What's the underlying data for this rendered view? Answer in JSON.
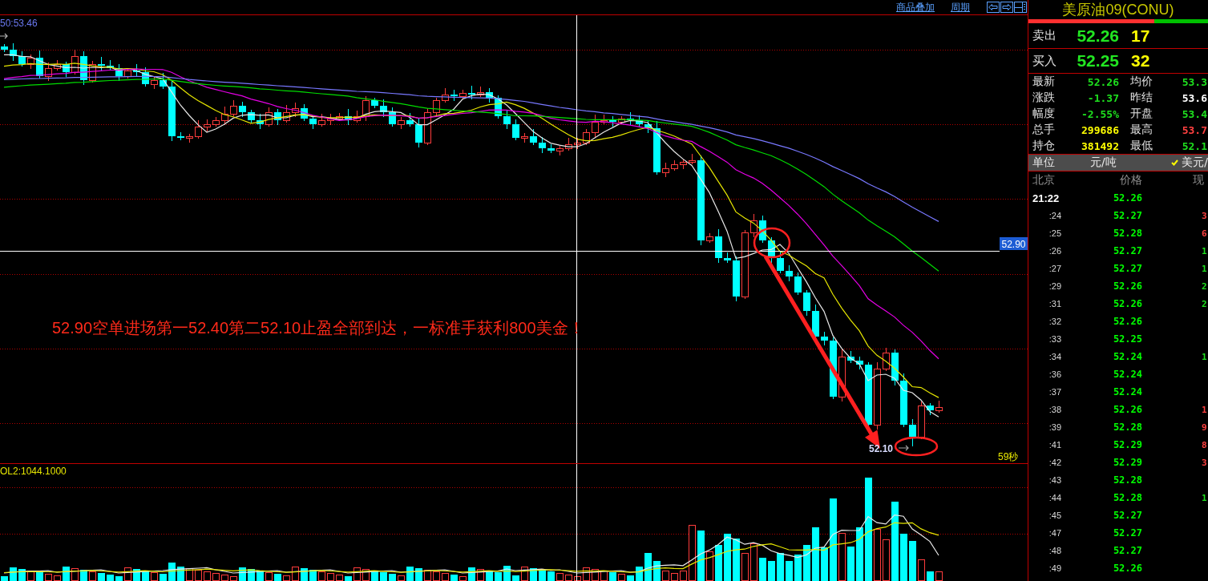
{
  "toolbar": {
    "links": [
      "商品叠加",
      "周期"
    ]
  },
  "price_chart": {
    "time_label": "50:53.46",
    "crosshair_label": "52.90",
    "annotation": "52.90空单进场第一52.40第二52.10止盈全部到达，一标准手获利800美金！",
    "low_label": "52.10",
    "countdown": "59秒"
  },
  "volume_chart": {
    "indicator_label": "OL2:1044.1000"
  },
  "quote_panel": {
    "title": "美原油09(CONU)",
    "ratio_bar": {
      "level": 0.7
    },
    "book": [
      {
        "label": "卖出",
        "price": "52.26",
        "volume": "17"
      },
      {
        "label": "买入",
        "price": "52.25",
        "volume": "32"
      }
    ],
    "stats": [
      {
        "label": "最新",
        "value": "52.26",
        "color": "#1ee01e"
      },
      {
        "label": "均价",
        "value": "53.3",
        "color": "#1ee01e"
      },
      {
        "label": "涨跌",
        "value": "-1.37",
        "color": "#1ee01e"
      },
      {
        "label": "昨结",
        "value": "53.6",
        "color": "#ffffff"
      },
      {
        "label": "幅度",
        "value": "-2.55%",
        "color": "#1ee01e"
      },
      {
        "label": "开盘",
        "value": "53.4",
        "color": "#1ee01e"
      },
      {
        "label": "总手",
        "value": "299686",
        "color": "#ffff00"
      },
      {
        "label": "最高",
        "value": "53.7",
        "color": "#ff4040"
      },
      {
        "label": "持仓",
        "value": "381492",
        "color": "#ffff00"
      },
      {
        "label": "最低",
        "value": "52.1",
        "color": "#1ee01e"
      }
    ],
    "units": {
      "label": "单位",
      "options": [
        {
          "label": "元/吨",
          "selected": false
        },
        {
          "label": "美元/",
          "selected": true
        }
      ]
    },
    "ticks": {
      "columns": [
        "北京",
        "价格",
        "现"
      ],
      "rows": [
        {
          "time": "21:22",
          "price": "52.26"
        },
        {
          "time": ":24",
          "price": "52.27",
          "volume": "3",
          "color": "#ff4040"
        },
        {
          "time": ":25",
          "price": "52.28",
          "volume": "6",
          "color": "#ff4040"
        },
        {
          "time": ":26",
          "price": "52.27",
          "volume": "1",
          "color": "#1ee01e"
        },
        {
          "time": ":27",
          "price": "52.27",
          "volume": "1",
          "color": "#1ee01e"
        },
        {
          "time": ":29",
          "price": "52.26",
          "volume": "2",
          "color": "#1ee01e"
        },
        {
          "time": ":31",
          "price": "52.26",
          "volume": "2",
          "color": "#1ee01e"
        },
        {
          "time": ":32",
          "price": "52.26"
        },
        {
          "time": ":33",
          "price": "52.25"
        },
        {
          "time": ":34",
          "price": "52.24",
          "volume": "1",
          "color": "#1ee01e"
        },
        {
          "time": ":36",
          "price": "52.24"
        },
        {
          "time": ":37",
          "price": "52.24"
        },
        {
          "time": ":38",
          "price": "52.26",
          "volume": "1",
          "color": "#ff4040"
        },
        {
          "time": ":39",
          "price": "52.28",
          "volume": "9",
          "color": "#ff4040"
        },
        {
          "time": ":41",
          "price": "52.29",
          "volume": "8",
          "color": "#ff4040"
        },
        {
          "time": ":42",
          "price": "52.29",
          "volume": "3",
          "color": "#ff4040"
        },
        {
          "time": ":43",
          "price": "52.28"
        },
        {
          "time": ":44",
          "price": "52.28",
          "volume": "1",
          "color": "#1ee01e"
        },
        {
          "time": ":45",
          "price": "52.27"
        },
        {
          "time": ":47",
          "price": "52.27"
        },
        {
          "time": ":48",
          "price": "52.27"
        },
        {
          "time": ":49",
          "price": "52.26"
        }
      ]
    }
  }
}
